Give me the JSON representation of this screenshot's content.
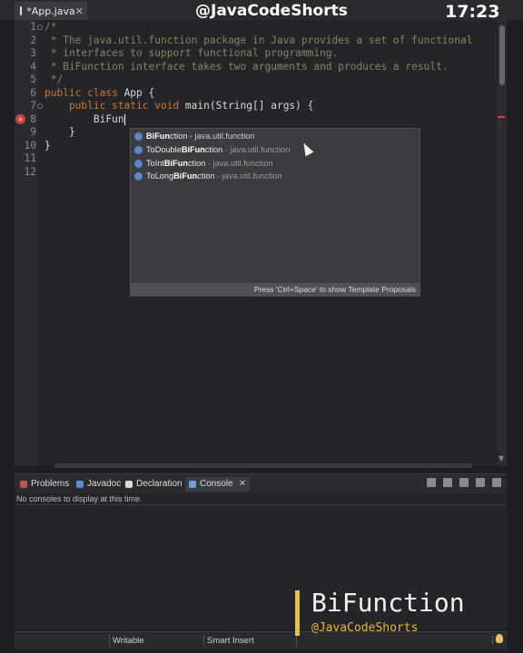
{
  "editor_tab": {
    "title": "*App.java",
    "close": "✕"
  },
  "overlay": {
    "channel": "@JavaCodeShorts",
    "clock": "17:23",
    "brand_title": "BiFunction",
    "brand_sub": "@JavaCodeShorts"
  },
  "code_lines": [
    {
      "n": "1",
      "text": "/*",
      "kind": "cmt"
    },
    {
      "n": "2",
      "text": " * The java.util.function package in Java provides a set of functional",
      "kind": "cmt"
    },
    {
      "n": "3",
      "text": " * interfaces to support functional programming.",
      "kind": "cmt"
    },
    {
      "n": "4",
      "text": " * BiFunction interface takes two arguments and produces a result.",
      "kind": "cmt"
    },
    {
      "n": "5",
      "text": " */",
      "kind": "cmt"
    },
    {
      "n": "6",
      "kw": "public class ",
      "rest": "App {",
      "kind": "mixed"
    },
    {
      "n": "7",
      "kw": "    public static void ",
      "rest": "main(String[] args) {",
      "kind": "mixed"
    },
    {
      "n": "8",
      "text": "        BiFun",
      "kind": "plain"
    },
    {
      "n": "9",
      "text": "    }",
      "kind": "plain"
    },
    {
      "n": "10",
      "text": "}",
      "kind": "plain"
    },
    {
      "n": "11",
      "text": "",
      "kind": "plain"
    },
    {
      "n": "12",
      "text": "",
      "kind": "plain"
    }
  ],
  "assist": {
    "items": [
      {
        "match": "BiFun",
        "rest": "ction",
        "pkg": " - java.util.function",
        "selected": true
      },
      {
        "pre": "ToDouble",
        "match": "BiFun",
        "rest": "ction",
        "pkg": " - java.util.function",
        "selected": false
      },
      {
        "pre": "ToInt",
        "match": "BiFun",
        "rest": "ction",
        "pkg": " - java.util.function",
        "selected": false
      },
      {
        "pre": "ToLong",
        "match": "BiFun",
        "rest": "ction",
        "pkg": " - java.util.function",
        "selected": false
      }
    ],
    "footer": "Press 'Ctrl+Space' to show Template Proposals"
  },
  "panel": {
    "tabs": [
      {
        "label": "Problems",
        "color": "#c94f4f"
      },
      {
        "label": "Javadoc",
        "color": "#5a8fd0"
      },
      {
        "label": "Declaration",
        "color": "#d9d9d9"
      },
      {
        "label": "Console",
        "color": "#6aa0d8",
        "active": true
      }
    ],
    "message": "No consoles to display at this time."
  },
  "statusbar": {
    "mode": "Writable",
    "insert": "Smart Insert",
    "more": "⋮"
  }
}
